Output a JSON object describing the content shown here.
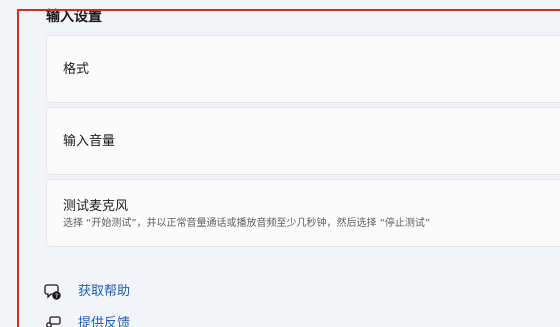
{
  "section": {
    "title": "输入设置"
  },
  "cards": [
    {
      "title": "格式"
    },
    {
      "title": "输入音量"
    },
    {
      "title": "测试麦克风",
      "description": "选择 “开始测试”，并以正常音量通话或播放音频至少几秒钟，然后选择 “停止测试”"
    }
  ],
  "links": [
    {
      "label": "获取帮助",
      "icon": "help-chat-icon"
    },
    {
      "label": "提供反馈",
      "icon": "feedback-icon"
    }
  ],
  "colors": {
    "highlight_frame": "#d62b2b",
    "link": "#1a5fb4"
  }
}
